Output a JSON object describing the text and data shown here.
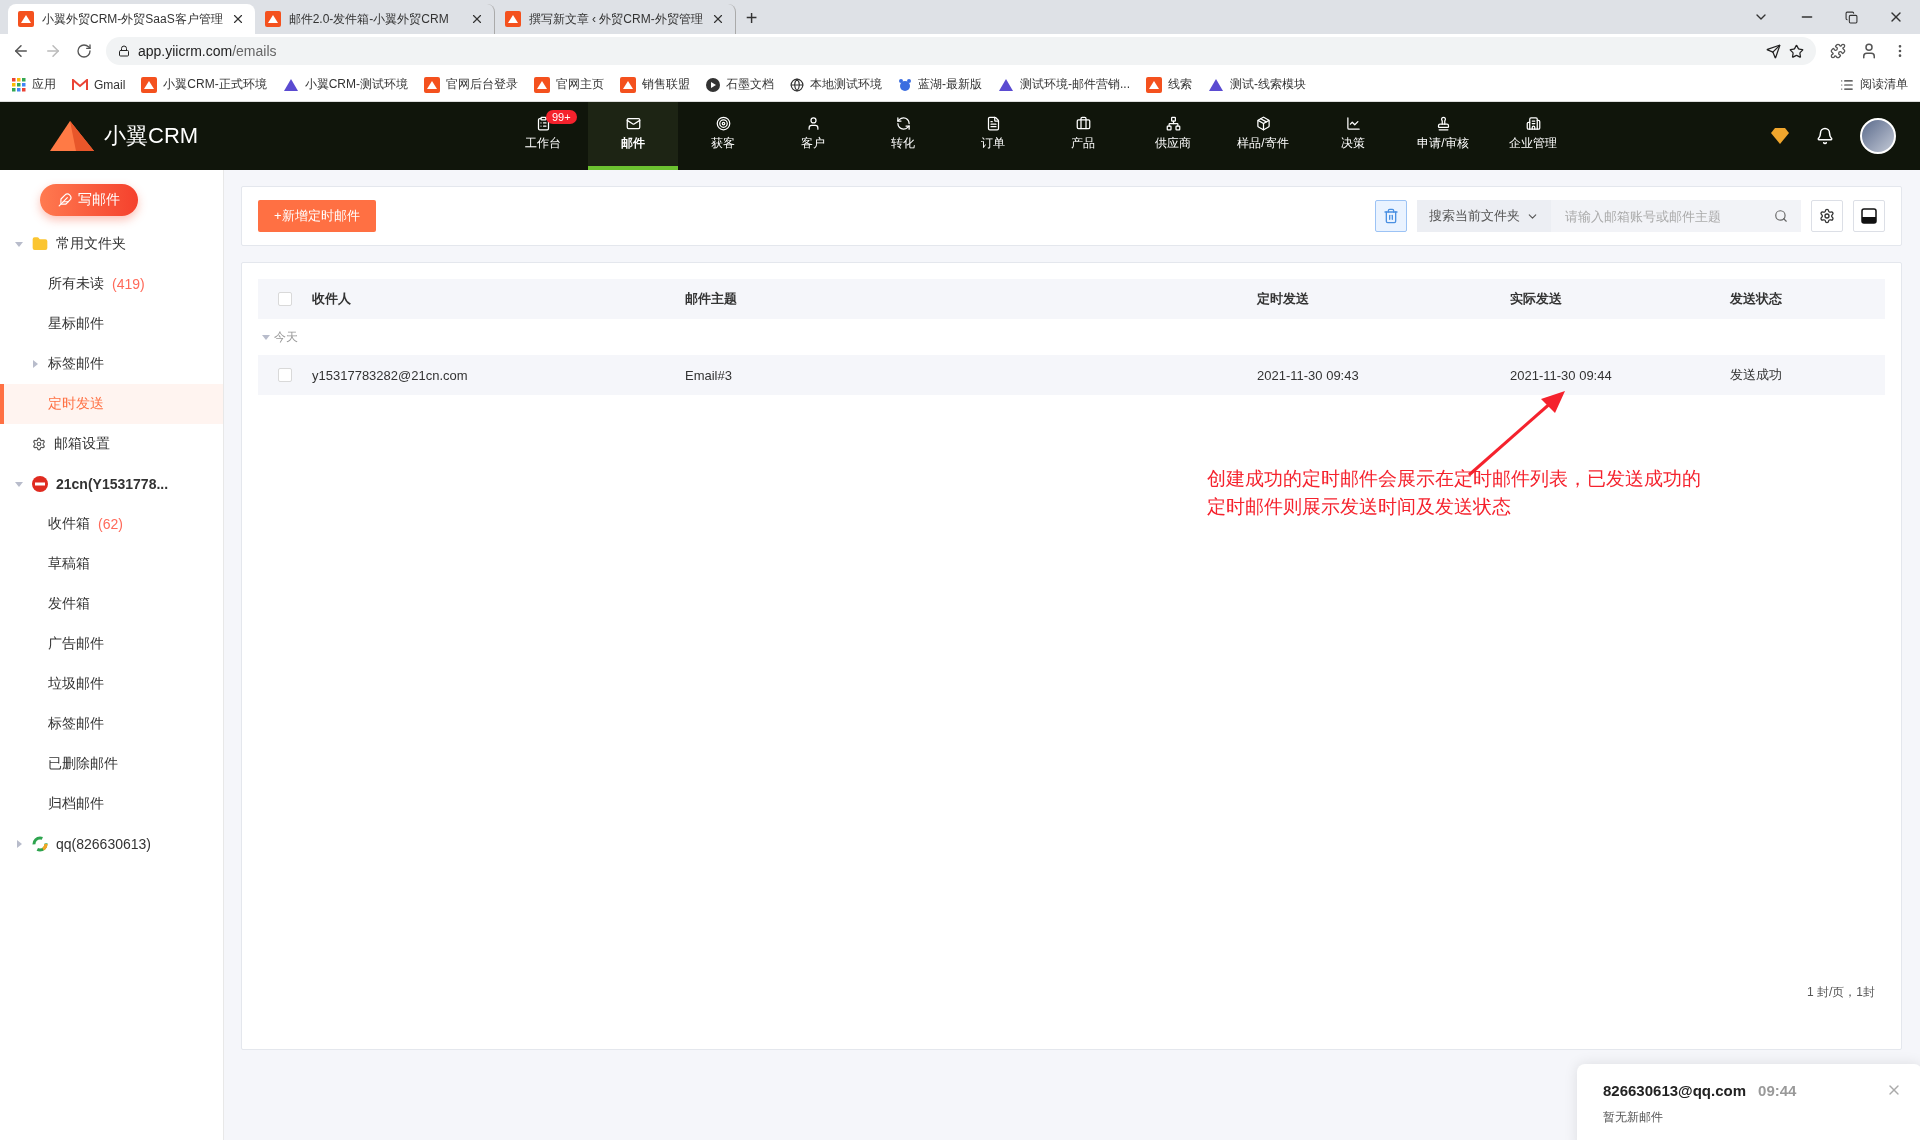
{
  "browser": {
    "tabs": [
      {
        "title": "小翼外贸CRM-外贸SaaS客户管理",
        "selected": true
      },
      {
        "title": "邮件2.0-发件箱-小翼外贸CRM",
        "selected": false
      },
      {
        "title": "撰写新文章 ‹ 外贸CRM-外贸管理",
        "selected": false
      }
    ],
    "new_tab": "+",
    "url_host": "app.yiicrm.com",
    "url_path": "/emails",
    "bookmarks": [
      "应用",
      "Gmail",
      "小翼CRM-正式环境",
      "小翼CRM-测试环境",
      "官网后台登录",
      "官网主页",
      "销售联盟",
      "石墨文档",
      "本地测试环境",
      "蓝湖-最新版",
      "测试环境-邮件营销...",
      "线索",
      "测试-线索模块"
    ],
    "reading_list": "阅读清单"
  },
  "app": {
    "logo": "小翼CRM",
    "nav": [
      {
        "label": "工作台",
        "badge": "99+",
        "selected": false
      },
      {
        "label": "邮件",
        "selected": true
      },
      {
        "label": "获客",
        "selected": false
      },
      {
        "label": "客户",
        "selected": false
      },
      {
        "label": "转化",
        "selected": false
      },
      {
        "label": "订单",
        "selected": false
      },
      {
        "label": "产品",
        "selected": false
      },
      {
        "label": "供应商",
        "selected": false
      },
      {
        "label": "样品/寄件",
        "selected": false
      },
      {
        "label": "决策",
        "selected": false
      },
      {
        "label": "申请/审核",
        "selected": false
      },
      {
        "label": "企业管理",
        "selected": false
      }
    ]
  },
  "sidebar": {
    "compose_button": "写邮件",
    "items": [
      {
        "label": "常用文件夹",
        "expanded": true,
        "children": [
          {
            "label": "所有未读",
            "count": "(419)",
            "selected": false
          },
          {
            "label": "星标邮件",
            "selected": false
          },
          {
            "label": "标签邮件",
            "expanded": false,
            "selected": false
          },
          {
            "label": "定时发送",
            "selected": true
          }
        ]
      },
      {
        "label": "邮箱设置"
      },
      {
        "label": "21cn(Y1531778...",
        "expanded": true,
        "children": [
          {
            "label": "收件箱",
            "count": "(62)",
            "selected": false
          },
          {
            "label": "草稿箱",
            "selected": false
          },
          {
            "label": "发件箱",
            "selected": false
          },
          {
            "label": "广告邮件",
            "selected": false
          },
          {
            "label": "垃圾邮件",
            "selected": false
          },
          {
            "label": "标签邮件",
            "selected": false
          },
          {
            "label": "已删除邮件",
            "selected": false
          },
          {
            "label": "归档邮件",
            "selected": false
          }
        ]
      },
      {
        "label": "qq(826630613)",
        "expanded": false
      }
    ]
  },
  "toolbar": {
    "add_button": "+新增定时邮件",
    "search_scope": "搜索当前文件夹",
    "search_placeholder": "请输入邮箱账号或邮件主题"
  },
  "table": {
    "columns": [
      "收件人",
      "邮件主题",
      "定时发送",
      "实际发送",
      "发送状态"
    ],
    "all_checked": false,
    "group": {
      "label": "今天",
      "expanded": true
    },
    "rows": [
      {
        "cells": [
          "y15317783282@21cn.com",
          "Email#3",
          "2021-11-30 09:43",
          "2021-11-30 09:44",
          "发送成功"
        ],
        "checked": false
      }
    ],
    "pagination": "1 封/页，1封"
  },
  "annotation": {
    "lines": [
      "创建成功的定时邮件会展示在定时邮件列表，已发送成功的",
      "定时邮件则展示发送时间及发送状态"
    ]
  },
  "notification": {
    "account": "826630613@qq.com",
    "time": "09:44",
    "message": "暂无新邮件"
  }
}
